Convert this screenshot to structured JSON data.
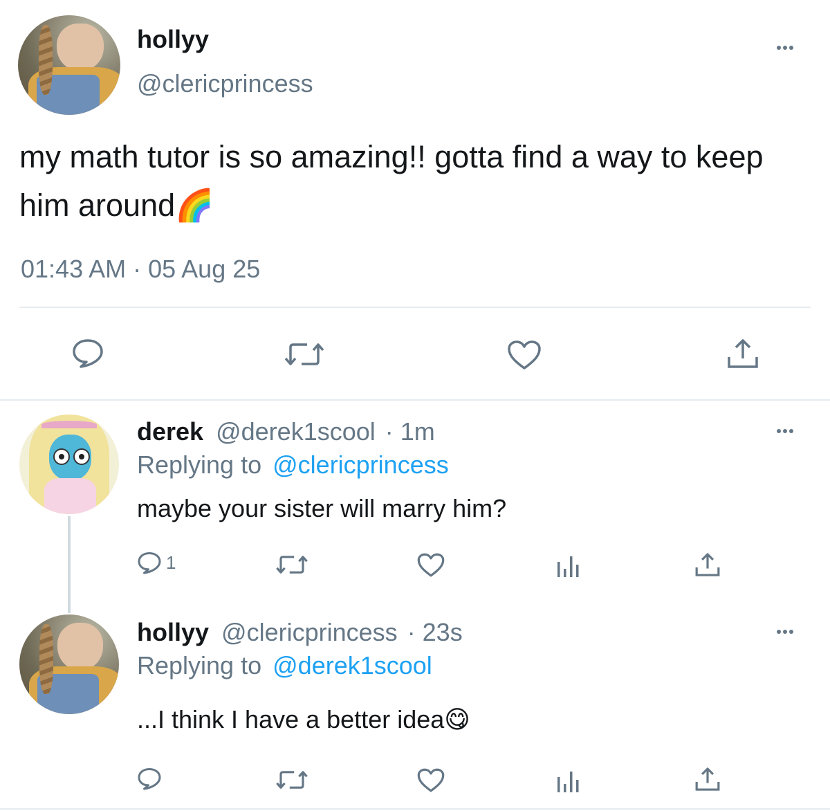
{
  "main_tweet": {
    "display_name": "hollyy",
    "handle": "@clericprincess",
    "text": "my math tutor is so amazing!! gotta find a way to keep him around🌈",
    "timestamp": "01:43 AM · 05 Aug 25",
    "actions": [
      "reply-icon",
      "retweet-icon",
      "like-icon",
      "share-icon"
    ]
  },
  "replies": [
    {
      "display_name": "derek",
      "handle": "@derek1scool",
      "time": "· 1m",
      "replying_label": "Replying to",
      "replying_to": "@clericprincess",
      "text": "maybe your sister will marry him?",
      "reply_count": "1"
    },
    {
      "display_name": "hollyy",
      "handle": "@clericprincess",
      "time": "· 23s",
      "replying_label": "Replying to",
      "replying_to": "@derek1scool",
      "text": "...I think I have a better idea😋",
      "reply_count": ""
    }
  ],
  "colors": {
    "text": "#14171a",
    "secondary": "#657786",
    "link": "#1da1f2",
    "divider": "#e6ecf0"
  }
}
